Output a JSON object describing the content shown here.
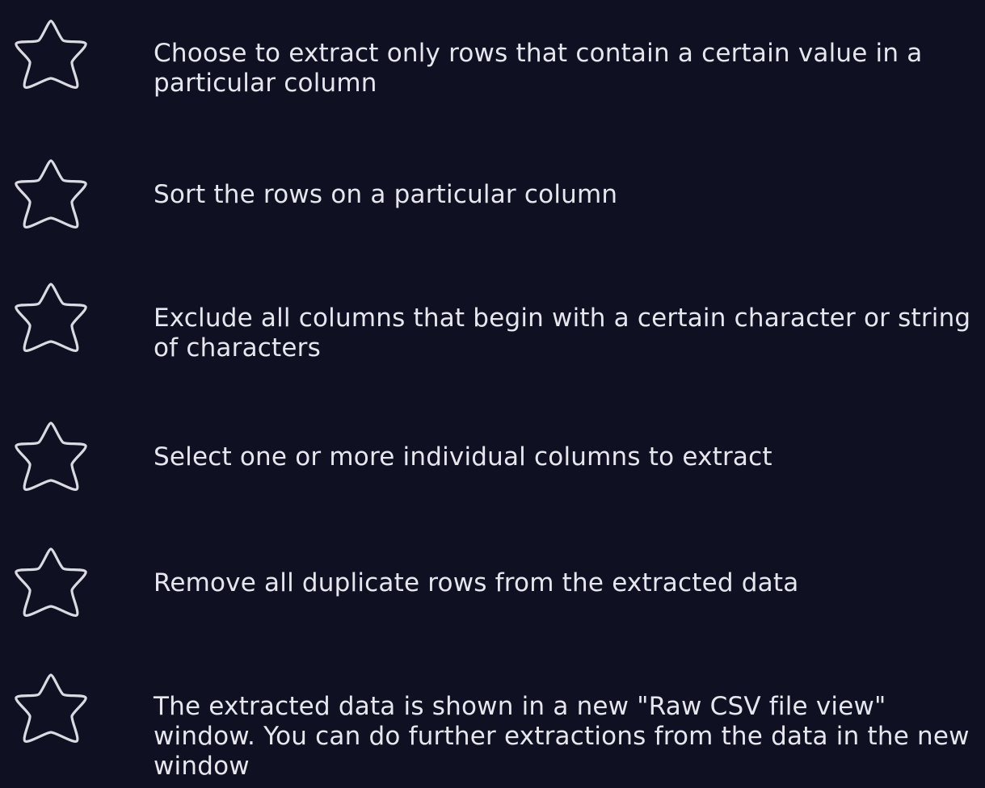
{
  "features": [
    {
      "icon": "star-icon",
      "text": "Choose to extract only rows that contain a certain value in a particular column"
    },
    {
      "icon": "star-icon",
      "text": "Sort the rows on a particular column"
    },
    {
      "icon": "star-icon",
      "text": "Exclude all columns that begin with a certain character or string of characters"
    },
    {
      "icon": "star-icon",
      "text": "Select one or more individual columns to extract"
    },
    {
      "icon": "star-icon",
      "text": "Remove all duplicate rows from the extracted data"
    },
    {
      "icon": "star-icon",
      "text": "The extracted data is shown in a new \"Raw CSV file view\" window. You can do further extractions from the data in the new window"
    }
  ],
  "colors": {
    "background": "#0f1122",
    "text": "#e6e7ee",
    "icon_stroke": "#d9dae2"
  }
}
